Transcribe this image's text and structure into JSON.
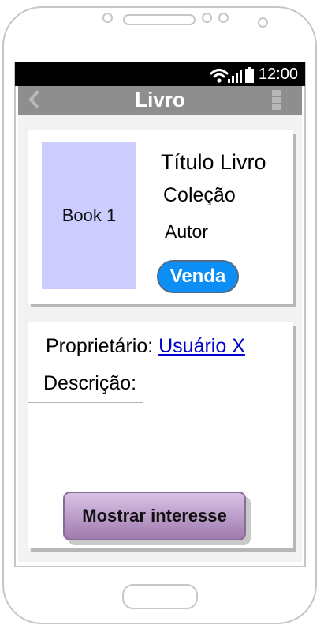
{
  "status_bar": {
    "time": "12:00"
  },
  "app_bar": {
    "title": "Livro"
  },
  "book": {
    "cover_label": "Book 1",
    "title": "Título Livro",
    "collection": "Coleção",
    "author": "Autor",
    "badge": "Venda"
  },
  "details": {
    "owner_label": "Proprietário:",
    "owner_link": "Usuário X",
    "description_label": "Descrição:"
  },
  "actions": {
    "interest_button": "Mostrar interesse"
  },
  "colors": {
    "app_bar": "#8e8e8e",
    "badge": "#0d8ef5",
    "cover": "#ccccff",
    "button_top": "#d9c3e5",
    "button_bottom": "#a07aaf",
    "link": "#0000cc"
  }
}
